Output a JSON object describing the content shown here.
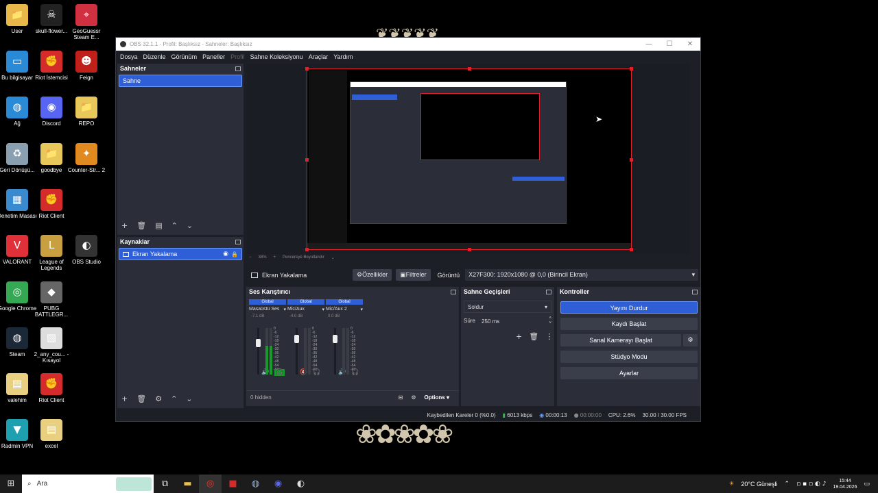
{
  "desktop": {
    "icons": [
      {
        "label": "User",
        "icon": "folder-user-icon",
        "color": "#e8b84a"
      },
      {
        "label": "skull-flower...",
        "icon": "skull-icon",
        "color": "#222222"
      },
      {
        "label": "GeoGuessr Steam E...",
        "icon": "map-pin-icon",
        "color": "#d03040"
      },
      {
        "label": "Bu bilgisayar",
        "icon": "computer-icon",
        "color": "#2b8ad6"
      },
      {
        "label": "Riot İstemcisi",
        "icon": "riot-icon",
        "color": "#d62b2b"
      },
      {
        "label": "Feign",
        "icon": "demon-icon",
        "color": "#c0201a"
      },
      {
        "label": "Ağ",
        "icon": "network-icon",
        "color": "#2b8ad6"
      },
      {
        "label": "Discord",
        "icon": "discord-icon",
        "color": "#5865f2"
      },
      {
        "label": "REPO",
        "icon": "folder-icon",
        "color": "#e8c85a"
      },
      {
        "label": "Geri Dönüşü...",
        "icon": "recycle-bin-icon",
        "color": "#8aa0b0"
      },
      {
        "label": "goodbye",
        "icon": "folder-icon",
        "color": "#e8c85a"
      },
      {
        "label": "Counter-Str... 2",
        "icon": "cs2-icon",
        "color": "#e08a20"
      },
      {
        "label": "Denetim Masası",
        "icon": "control-panel-icon",
        "color": "#3a8ad0"
      },
      {
        "label": "Riot Client",
        "icon": "riot-icon",
        "color": "#d62b2b"
      },
      {
        "label": "VALORANT",
        "icon": "valorant-icon",
        "color": "#e0303a"
      },
      {
        "label": "League of Legends",
        "icon": "lol-icon",
        "color": "#c8a040"
      },
      {
        "label": "OBS Studio",
        "icon": "obs-icon",
        "color": "#333333"
      },
      {
        "label": "Google Chrome",
        "icon": "chrome-icon",
        "color": "#34a853"
      },
      {
        "label": "PUBG BATTLEGR...",
        "icon": "pubg-icon",
        "color": "#666666"
      },
      {
        "label": "Steam",
        "icon": "steam-icon",
        "color": "#1b2838"
      },
      {
        "label": "2_any_cou... - Kısayol",
        "icon": "shortcut-icon",
        "color": "#dddddd"
      },
      {
        "label": "valehim",
        "icon": "file-icon",
        "color": "#e8d080"
      },
      {
        "label": "Riot Client",
        "icon": "riot-icon",
        "color": "#d62b2b"
      },
      {
        "label": "Radmin VPN",
        "icon": "vpn-icon",
        "color": "#1fa0b0"
      },
      {
        "label": "excel",
        "icon": "file-icon",
        "color": "#e8d080"
      }
    ]
  },
  "obs": {
    "title": "OBS 32.1.1 - Profil: Başlıksız - Sahneler: Başlıksız",
    "window_controls": [
      "—",
      "☐",
      "✕"
    ],
    "menu": [
      "Dosya",
      "Düzenle",
      "Görünüm",
      "Paneller",
      "Profil",
      "Sahne Koleksiyonu",
      "Araçlar",
      "Yardım"
    ],
    "scenes": {
      "title": "Sahneler",
      "items": [
        "Sahne"
      ]
    },
    "sources": {
      "title": "Kaynaklar",
      "items": [
        "Ekran Yakalama"
      ]
    },
    "preview_bar": {
      "zoom": "38%",
      "fit": "Pencereye Boyutlandır"
    },
    "source_bar": {
      "source": "Ekran Yakalama",
      "properties": "Özellikler",
      "filters": "Filtreler",
      "display_label": "Görüntü",
      "display_value": "X27F300: 1920x1080 @ 0,0 (Birincil Ekran)"
    },
    "mixer": {
      "title": "Ses Karıştırıcı",
      "channels": [
        {
          "scope": "Global",
          "name": "Masaüstü Ses",
          "db": "-7.1 dB",
          "level": 0.62
        },
        {
          "scope": "Global",
          "name": "Mic/Aux",
          "db": "-4.0 dB",
          "level": 0.0
        },
        {
          "scope": "Global",
          "name": "Mic/Aux 2",
          "db": "0.0 dB",
          "level": 0.0
        }
      ],
      "scale": [
        "0",
        "-6",
        "-12",
        "-18",
        "-24",
        "-30",
        "-36",
        "-42",
        "-48",
        "-54",
        "-60"
      ],
      "hidden": "0 hidden",
      "options": "Options"
    },
    "transitions": {
      "title": "Sahne Geçişleri",
      "type": "Soldur",
      "duration_label": "Süre",
      "duration": "250 ms"
    },
    "controls": {
      "title": "Kontroller",
      "stop_stream": "Yayını Durdur",
      "start_record": "Kaydı Başlat",
      "start_vcam": "Sanal Kamerayı Başlat",
      "studio_mode": "Stüdyo Modu",
      "settings": "Ayarlar"
    },
    "status": {
      "dropped": "Kaybedilen Kareler 0 (%0.0)",
      "bitrate": "6013 kbps",
      "stream_time": "00:00:13",
      "record_time": "00:00:00",
      "cpu": "CPU: 2.6%",
      "fps": "30.00 / 30.00 FPS"
    },
    "colors": {
      "accent": "#2f5fd6",
      "selection_border": "#e0202a",
      "meter": "#159a2b"
    }
  },
  "taskbar": {
    "search_placeholder": "Ara",
    "weather": "20°C  Güneşli",
    "time": "15:44",
    "date": "19.04.2026"
  }
}
